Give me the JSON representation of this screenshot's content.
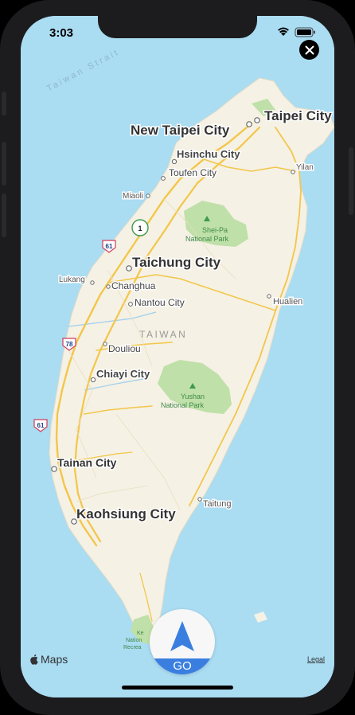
{
  "status": {
    "time": "3:03"
  },
  "map": {
    "water_label": "Taiwan Strait",
    "island_label": "TAIWAN",
    "cities": [
      {
        "name": "New Taipei City",
        "type": "major"
      },
      {
        "name": "Taipei City",
        "type": "major"
      },
      {
        "name": "Taichung City",
        "type": "major"
      },
      {
        "name": "Tainan City",
        "type": "major"
      },
      {
        "name": "Kaohsiung City",
        "type": "major"
      },
      {
        "name": "Hsinchu City",
        "type": "medium"
      },
      {
        "name": "Toufen City",
        "type": "minor"
      },
      {
        "name": "Nantou City",
        "type": "minor"
      },
      {
        "name": "Chiayi City",
        "type": "medium"
      },
      {
        "name": "Miaoli",
        "type": "minor"
      },
      {
        "name": "Lukang",
        "type": "minor"
      },
      {
        "name": "Changhua",
        "type": "minor"
      },
      {
        "name": "Douliou",
        "type": "minor"
      },
      {
        "name": "Yilan",
        "type": "minor"
      },
      {
        "name": "Hualien",
        "type": "minor"
      },
      {
        "name": "Taitung",
        "type": "minor"
      }
    ],
    "parks": [
      {
        "line1": "Shei-Pa",
        "line2": "National Park"
      },
      {
        "line1": "Yushan",
        "line2": "National Park"
      },
      {
        "line1": "Ke",
        "line2": "Nation",
        "line3": "Recrea"
      }
    ],
    "shields": [
      "61",
      "78",
      "61",
      "1"
    ]
  },
  "footer": {
    "brand": "Maps",
    "legal": "Legal"
  },
  "go_button": {
    "label": "GO"
  },
  "colors": {
    "water": "#aadcf2",
    "land": "#f5f1e4",
    "park": "#bfe0a8",
    "road": "#f3c64a",
    "go_band": "#3a7fe0"
  }
}
